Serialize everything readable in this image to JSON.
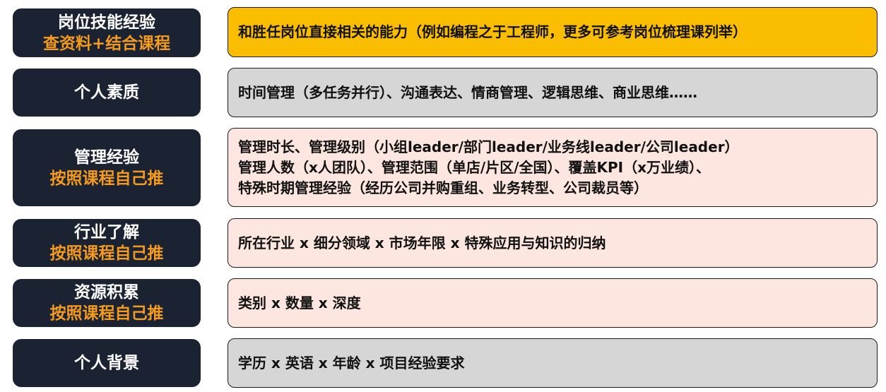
{
  "colors": {
    "label_bg": "#1b2232",
    "label_title": "#ffffff",
    "label_sub": "#f39a1f",
    "content_yellow": "#fbbd00",
    "content_gray": "#d6d6d6",
    "content_pink": "#fde6e0"
  },
  "rows": [
    {
      "title": "岗位技能经验",
      "subtitle": "查资料+结合课程",
      "lines": [
        "和胜任岗位直接相关的能力（例如编程之于工程师，更多可参考岗位梳理课列举）"
      ]
    },
    {
      "title": "个人素质",
      "subtitle": "",
      "lines": [
        "时间管理（多任务并行）、沟通表达、情商管理、逻辑思维、商业思维……"
      ]
    },
    {
      "title": "管理经验",
      "subtitle": "按照课程自己推",
      "lines": [
        "管理时长、管理级别（小组leader/部门leader/业务线leader/公司leader）",
        "管理人数（x人团队）、管理范围（单店/片区/全国）、覆盖KPI（x万业绩）、",
        "特殊时期管理经验（经历公司并购重组、业务转型、公司裁员等）"
      ]
    },
    {
      "title": "行业了解",
      "subtitle": "按照课程自己推",
      "lines": [
        "所在行业 x 细分领域 x 市场年限 x 特殊应用与知识的归纳"
      ]
    },
    {
      "title": "资源积累",
      "subtitle": "按照课程自己推",
      "lines": [
        "类别 x 数量 x 深度"
      ]
    },
    {
      "title": "个人背景",
      "subtitle": "",
      "lines": [
        "学历 x 英语 x 年龄 x 项目经验要求"
      ]
    }
  ]
}
